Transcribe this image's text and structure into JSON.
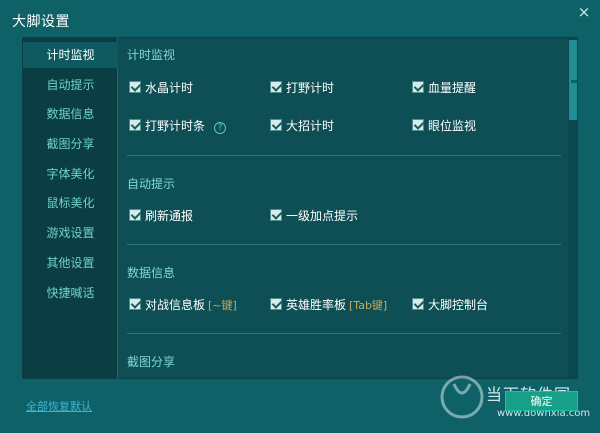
{
  "window": {
    "title": "大脚设置",
    "close_glyph": "×"
  },
  "sidebar": {
    "items": [
      {
        "label": "计时监视",
        "active": true
      },
      {
        "label": "自动提示"
      },
      {
        "label": "数据信息"
      },
      {
        "label": "截图分享"
      },
      {
        "label": "字体美化"
      },
      {
        "label": "鼠标美化"
      },
      {
        "label": "游戏设置"
      },
      {
        "label": "其他设置"
      },
      {
        "label": "快捷喊话"
      }
    ]
  },
  "sections": [
    {
      "title": "计时监视",
      "options": [
        {
          "label": "水晶计时",
          "checked": true
        },
        {
          "label": "打野计时",
          "checked": true
        },
        {
          "label": "血量提醒",
          "checked": true
        },
        {
          "label": "打野计时条",
          "checked": true,
          "help": "?"
        },
        {
          "label": "大招计时",
          "checked": true
        },
        {
          "label": "眼位监视",
          "checked": true
        }
      ]
    },
    {
      "title": "自动提示",
      "options": [
        {
          "label": "刷新通报",
          "checked": true
        },
        {
          "label": "一级加点提示",
          "checked": true
        }
      ]
    },
    {
      "title": "数据信息",
      "options": [
        {
          "label": "对战信息板",
          "hint": "[~键]",
          "checked": true
        },
        {
          "label": "英雄胜率板",
          "hint": "[Tab键]",
          "checked": true
        },
        {
          "label": "大脚控制台",
          "checked": true
        }
      ]
    },
    {
      "title": "截图分享",
      "options": []
    }
  ],
  "footer": {
    "restore_label": "全部恢复默认",
    "ok_label": "确定"
  },
  "watermark": {
    "text": "当下软件园",
    "url": "www.downxia.com"
  },
  "colors": {
    "background": "#0f6168",
    "accent": "#16a089",
    "section_title": "#7fd8d0"
  }
}
